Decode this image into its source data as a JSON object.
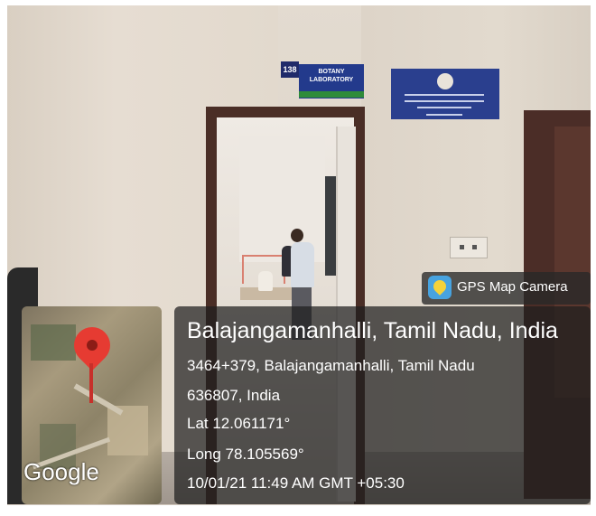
{
  "signs": {
    "room_number": "138",
    "room_label": "BOTANY LABORATORY"
  },
  "badge": {
    "app_name": "GPS Map Camera",
    "icon": "gps-map-camera-icon"
  },
  "location": {
    "title": "Balajangamanhalli, Tamil Nadu, India",
    "address_line1": "3464+379, Balajangamanhalli, Tamil Nadu",
    "address_line2": "636807, India",
    "latitude": "Lat 12.061171°",
    "longitude": "Long 78.105569°",
    "timestamp": "10/01/21 11:49 AM GMT +05:30"
  },
  "map": {
    "brand": "Google",
    "pin_icon": "map-pin-icon",
    "pin_color": "#e63b32"
  }
}
